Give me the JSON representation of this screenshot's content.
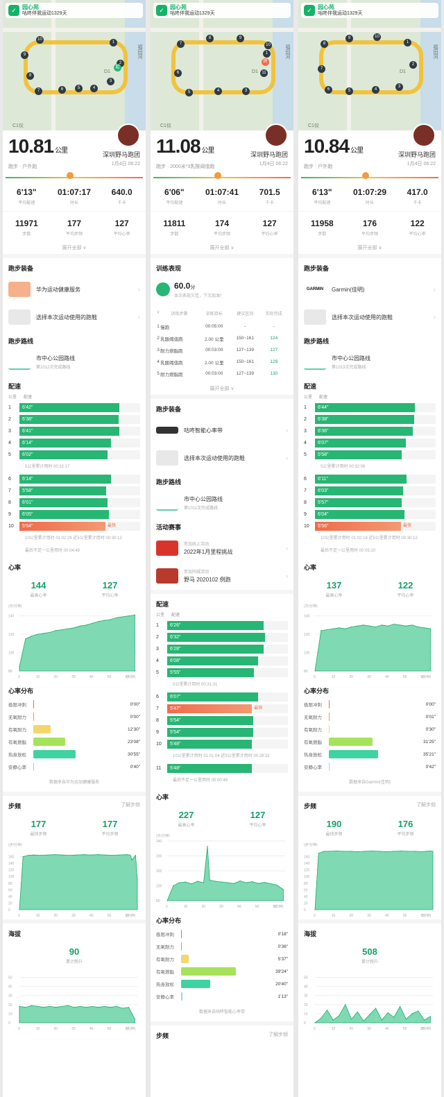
{
  "banner": {
    "brand": "园心苑",
    "text": "咕咚伴我运动1329天"
  },
  "map_labels": {
    "water": "福田河",
    "c1": "C1仪",
    "d1": "D1"
  },
  "columns": [
    {
      "distance": "10.81",
      "unit": "公里",
      "mode": "跑步 · 户外跑",
      "club": "深圳野马跑团",
      "date": "1月4日 06:22",
      "speed_left": "",
      "speed_right": "",
      "stats": [
        {
          "v": "6'13\"",
          "l": "平均配速"
        },
        {
          "v": "01:07:17",
          "l": "时长"
        },
        {
          "v": "640.0",
          "l": "千卡"
        }
      ],
      "stats2": [
        {
          "v": "11971",
          "l": "步数"
        },
        {
          "v": "177",
          "l": "平均步频"
        },
        {
          "v": "127",
          "l": "平均心率"
        }
      ],
      "more": "展开全部 ∨",
      "equip_title": "跑步装备",
      "equip": [
        {
          "label": "华为运动健康服务",
          "color": "#f7b18a"
        },
        {
          "label": "选择本次运动使用的跑鞋",
          "color": "#e8e8e8"
        }
      ],
      "route_title": "跑步路线",
      "route": {
        "name": "市中心公园路线",
        "sub": "第1012次完成路线"
      },
      "pace_title": "配速",
      "pace_hd": [
        "公里",
        "配速"
      ],
      "pace1": [
        {
          "n": "1",
          "p": "6'42\"",
          "f": 0.83
        },
        {
          "n": "2",
          "p": "6'38\"",
          "f": 0.82
        },
        {
          "n": "3",
          "p": "6'41\"",
          "f": 0.83
        },
        {
          "n": "4",
          "p": "6'14\"",
          "f": 0.76
        },
        {
          "n": "5",
          "p": "6'02\"",
          "f": 0.73
        }
      ],
      "pace1_note": "5公里累计用时 00:32:17",
      "pace2": [
        {
          "n": "6",
          "p": "6'14\"",
          "f": 0.76
        },
        {
          "n": "7",
          "p": "5'58\"",
          "f": 0.72
        },
        {
          "n": "8",
          "p": "6'01\"",
          "f": 0.73
        },
        {
          "n": "9",
          "p": "6'05\"",
          "f": 0.74
        },
        {
          "n": "10",
          "p": "5'54\"",
          "f": 0.71,
          "fast": true
        }
      ],
      "fast_tag": "最快",
      "pace2_note": "10公里累计用时 01:02:29  近5公里累计用时 00:30:12",
      "pace3_note": "最后不足一公里用时 00:04:48",
      "hr_title": "心率",
      "hr": [
        {
          "v": "144",
          "l": "最高心率"
        },
        {
          "v": "127",
          "l": "平均心率"
        }
      ],
      "hr_unit": "(次/分钟)",
      "zone_title": "心率分布",
      "zones": [
        {
          "n": "极限冲刺",
          "t": "0'00\"",
          "f": 0,
          "c": "#f06b4b"
        },
        {
          "n": "无氧耐力",
          "t": "0'00\"",
          "f": 0,
          "c": "#f39a3a"
        },
        {
          "n": "有氧耐力",
          "t": "12'30\"",
          "f": 0.2,
          "c": "#f5d66a"
        },
        {
          "n": "有氧燃脂",
          "t": "23'08\"",
          "f": 0.37,
          "c": "#a6e35a"
        },
        {
          "n": "热身放松",
          "t": "30'55\"",
          "f": 0.49,
          "c": "#3ed3a0"
        },
        {
          "n": "安静心率",
          "t": "0'40\"",
          "f": 0.01,
          "c": "#8fd9f0"
        }
      ],
      "zone_src": "数据来自华为运动健康服务",
      "cad_title": "步频",
      "cad_link": "了解步频",
      "cad": [
        {
          "v": "177",
          "l": "最快步频"
        },
        {
          "v": "177",
          "l": "平均步频"
        }
      ],
      "cad_unit": "(步/分钟)",
      "alt_title": "海拔",
      "alt": {
        "v": "90",
        "l": "累计爬升"
      }
    },
    {
      "distance": "11.08",
      "unit": "公里",
      "mode": "跑步 · 2000米*3乳酸阈值跑",
      "club": "深圳野马跑团",
      "date": "1月4日 06:22",
      "stats": [
        {
          "v": "6'06\"",
          "l": "平均配速"
        },
        {
          "v": "01:07:41",
          "l": "时长"
        },
        {
          "v": "701.5",
          "l": "千卡"
        }
      ],
      "stats2": [
        {
          "v": "11811",
          "l": "步数"
        },
        {
          "v": "174",
          "l": "平均步频"
        },
        {
          "v": "127",
          "l": "平均心率"
        }
      ],
      "more": "展开全部 ∨",
      "train_title": "训练表现",
      "train_score": "60.0",
      "train_score_unit": "分",
      "train_note": "本次表现欠佳，下次加油！",
      "train_hd": [
        "#",
        "训练步骤",
        "训练目标",
        "建议区间",
        "实际完成"
      ],
      "train_rows": [
        [
          "1",
          "慢跑",
          "00:05:00",
          "-",
          "-"
        ],
        [
          "2",
          "乳酸阈值跑",
          "2.00 公里",
          "150~161",
          "124"
        ],
        [
          "3",
          "耐力燃脂跑",
          "00:03:00",
          "127~139",
          "127"
        ],
        [
          "4",
          "乳酸阈值跑",
          "2.00 公里",
          "150~161",
          "129"
        ],
        [
          "5",
          "耐力燃脂跑",
          "00:03:00",
          "127~139",
          "130"
        ]
      ],
      "equip_title": "跑步装备",
      "equip": [
        {
          "label": "咕咚智能心率带",
          "color": "#333"
        },
        {
          "label": "选择本次运动使用的跑鞋",
          "color": "#e8e8e8"
        }
      ],
      "route_title": "跑步路线",
      "route": {
        "name": "市中心公园路线",
        "sub": "第1011次完成路线"
      },
      "event_title": "活动赛事",
      "events": [
        {
          "tag": "参加线上活动",
          "name": "2022年1月里程挑战",
          "color": "#d9342a"
        },
        {
          "tag": "参加同城活动",
          "name": "野马 2020102 例跑",
          "color": "#b93a2c"
        }
      ],
      "pace_title": "配速",
      "pace_hd": [
        "公里",
        "配速"
      ],
      "pace1": [
        {
          "n": "1",
          "p": "6'26\"",
          "f": 0.8
        },
        {
          "n": "2",
          "p": "6'32\"",
          "f": 0.81
        },
        {
          "n": "3",
          "p": "6'28\"",
          "f": 0.8
        },
        {
          "n": "4",
          "p": "6'08\"",
          "f": 0.75
        },
        {
          "n": "5",
          "p": "5'55\"",
          "f": 0.72
        }
      ],
      "pace1_note": "5公里累计用时 00:31:31",
      "pace2": [
        {
          "n": "6",
          "p": "6'07\"",
          "f": 0.75
        },
        {
          "n": "7",
          "p": "5'47\"",
          "f": 0.7,
          "fast": true
        },
        {
          "n": "8",
          "p": "5'54\"",
          "f": 0.71
        },
        {
          "n": "9",
          "p": "5'54\"",
          "f": 0.71
        },
        {
          "n": "10",
          "p": "5'48\"",
          "f": 0.7
        }
      ],
      "fast_tag": "最快",
      "pace2_note": "10公里累计用时 01:01:04  近5公里累计用时 00:29:32",
      "pace3": [
        {
          "n": "11",
          "p": "5'48\"",
          "f": 0.7
        }
      ],
      "pace3_note": "最后不足一公里用时 00:00:48",
      "hr_title": "心率",
      "hr": [
        {
          "v": "227",
          "l": "最高心率"
        },
        {
          "v": "127",
          "l": "平均心率"
        }
      ],
      "hr_unit": "(次/分钟)",
      "zone_title": "心率分布",
      "zones": [
        {
          "n": "极限冲刺",
          "t": "0'18\"",
          "f": 0.01,
          "c": "#f06b4b"
        },
        {
          "n": "无氧耐力",
          "t": "0'36\"",
          "f": 0.01,
          "c": "#f39a3a"
        },
        {
          "n": "有氧耐力",
          "t": "5'37\"",
          "f": 0.09,
          "c": "#f5d66a"
        },
        {
          "n": "有氧燃脂",
          "t": "39'24\"",
          "f": 0.64,
          "c": "#a6e35a"
        },
        {
          "n": "热身放松",
          "t": "20'40\"",
          "f": 0.34,
          "c": "#3ed3a0"
        },
        {
          "n": "安静心率",
          "t": "1'13\"",
          "f": 0.02,
          "c": "#8fd9f0"
        }
      ],
      "zone_src": "数据来自咕咚智能心率带",
      "cad_title": "步频",
      "cad_link": "了解步频"
    },
    {
      "distance": "10.84",
      "unit": "公里",
      "mode": "跑步 · 户外跑",
      "club": "深圳野马跑团",
      "date": "1月4日 06:22",
      "stats": [
        {
          "v": "6'13\"",
          "l": "平均配速"
        },
        {
          "v": "01:07:29",
          "l": "时长"
        },
        {
          "v": "417.0",
          "l": "千卡"
        }
      ],
      "stats2": [
        {
          "v": "11958",
          "l": "步数"
        },
        {
          "v": "176",
          "l": "平均步频"
        },
        {
          "v": "122",
          "l": "平均心率"
        }
      ],
      "more": "展开全部 ∨",
      "equip_title": "跑步装备",
      "equip": [
        {
          "label": "Garmin(佳明)",
          "color": "#fff"
        },
        {
          "label": "选择本次运动使用的跑鞋",
          "color": "#e8e8e8"
        }
      ],
      "route_title": "跑步路线",
      "route": {
        "name": "市中心公园路线",
        "sub": "第1013次完成路线"
      },
      "pace_title": "配速",
      "pace_hd": [
        "公里",
        "配速"
      ],
      "pace1": [
        {
          "n": "1",
          "p": "6'44\"",
          "f": 0.83
        },
        {
          "n": "2",
          "p": "6'38\"",
          "f": 0.82
        },
        {
          "n": "3",
          "p": "6'36\"",
          "f": 0.81
        },
        {
          "n": "4",
          "p": "6'07\"",
          "f": 0.75
        },
        {
          "n": "5",
          "p": "5'58\"",
          "f": 0.72
        }
      ],
      "pace1_note": "5公里累计用时 00:32:06",
      "pace2": [
        {
          "n": "6",
          "p": "6'11\"",
          "f": 0.76
        },
        {
          "n": "7",
          "p": "6'03\"",
          "f": 0.73
        },
        {
          "n": "8",
          "p": "5'57\"",
          "f": 0.72
        },
        {
          "n": "9",
          "p": "6'04\"",
          "f": 0.74
        },
        {
          "n": "10",
          "p": "5'56\"",
          "f": 0.71,
          "fast": true
        }
      ],
      "fast_tag": "最快",
      "pace2_note": "10公里累计用时 01:02:18  近5公里累计用时 00:30:12",
      "pace3_note": "最后不足一公里用时 00:05:10",
      "hr_title": "心率",
      "hr": [
        {
          "v": "137",
          "l": "最高心率"
        },
        {
          "v": "122",
          "l": "平均心率"
        }
      ],
      "hr_unit": "(次/分钟)",
      "zone_title": "心率分布",
      "zones": [
        {
          "n": "极限冲刺",
          "t": "0'00\"",
          "f": 0,
          "c": "#f06b4b"
        },
        {
          "n": "无氧耐力",
          "t": "0'01\"",
          "f": 0.005,
          "c": "#f39a3a"
        },
        {
          "n": "有氧耐力",
          "t": "0'30\"",
          "f": 0.01,
          "c": "#f5d66a"
        },
        {
          "n": "有氧燃脂",
          "t": "31'25\"",
          "f": 0.51,
          "c": "#a6e35a"
        },
        {
          "n": "热身放松",
          "t": "35'21\"",
          "f": 0.57,
          "c": "#3ed3a0"
        },
        {
          "n": "安静心率",
          "t": "0'42\"",
          "f": 0.01,
          "c": "#8fd9f0"
        }
      ],
      "zone_src": "数据来自Garmin(佳明)",
      "cad_title": "步频",
      "cad_link": "了解步频",
      "cad": [
        {
          "v": "190",
          "l": "最快步频"
        },
        {
          "v": "176",
          "l": "平均步频"
        }
      ],
      "cad_unit": "(步/分钟)",
      "alt_title": "海拔",
      "alt": {
        "v": "508",
        "l": "累计爬升"
      }
    }
  ],
  "chart_data": [
    {
      "type": "area",
      "series": [
        {
          "values": [
            85,
            115,
            118,
            120,
            121,
            122,
            124,
            125,
            126,
            127,
            129,
            130,
            132,
            134,
            135,
            136,
            138,
            139,
            140,
            141
          ]
        }
      ],
      "x": [
        0,
        3.4,
        6.8,
        10.2,
        13.6,
        17,
        20.4,
        23.8,
        27.2,
        30.6,
        34,
        37.4,
        40.8,
        44.2,
        47.6,
        51,
        54.4,
        57.8,
        61.2,
        64.6
      ],
      "xticks": [
        0,
        10,
        20,
        30,
        40,
        50,
        60
      ],
      "yticks": [
        80,
        100,
        120,
        140
      ],
      "ylim": [
        80,
        145
      ],
      "xlabel": "(分钟)",
      "ylabel": "(次/分钟)"
    },
    {
      "type": "area",
      "series": [
        {
          "values": [
            0,
            160,
            164,
            165,
            164,
            165,
            166,
            165,
            164,
            165,
            166,
            165,
            166,
            165,
            164,
            165,
            166,
            165,
            150,
            164,
            90
          ]
        }
      ],
      "x": [
        0,
        2,
        5,
        8,
        12,
        16,
        20,
        24,
        28,
        32,
        36,
        40,
        44,
        48,
        52,
        56,
        60,
        62,
        63,
        65,
        66
      ],
      "xticks": [
        0,
        10,
        20,
        30,
        40,
        50,
        60
      ],
      "yticks": [
        0,
        20,
        40,
        60,
        80,
        100,
        120,
        140,
        160
      ],
      "ylim": [
        0,
        180
      ],
      "xlabel": "(分钟)",
      "ylabel": "(步/分钟)"
    },
    {
      "type": "area",
      "series": [
        {
          "values": [
            18,
            17,
            19,
            18,
            17,
            18,
            17,
            18,
            19,
            17,
            18,
            17,
            18,
            17,
            18,
            17,
            18,
            16,
            17,
            4
          ]
        }
      ],
      "x": [
        0,
        3.4,
        6.8,
        10.2,
        13.6,
        17,
        20.4,
        23.8,
        27.2,
        30.6,
        34,
        37.4,
        40.8,
        44.2,
        47.6,
        51,
        54.4,
        57.8,
        61.2,
        64.6
      ],
      "xticks": [
        0,
        10,
        20,
        30,
        40,
        50,
        60
      ],
      "yticks": [
        0,
        10,
        20,
        30,
        40,
        50
      ],
      "ylim": [
        0,
        55
      ],
      "xlabel": "(分钟)",
      "ylabel": "(米)"
    },
    {
      "type": "area",
      "series": [
        {
          "values": [
            80,
            120,
            128,
            130,
            125,
            132,
            128,
            135,
            226,
            132,
            130,
            128,
            126,
            133,
            128,
            131,
            126,
            129,
            122,
            110
          ]
        }
      ],
      "x": [
        0,
        3.4,
        6.8,
        10.2,
        13.6,
        17,
        20.4,
        23.8,
        22.5,
        27.2,
        30.6,
        34,
        37.4,
        40.8,
        44.2,
        47.6,
        51,
        54.4,
        61.2,
        65
      ],
      "xticks": [
        0,
        10,
        20,
        30,
        40,
        50,
        60
      ],
      "yticks": [
        80,
        120,
        160,
        200,
        240
      ],
      "ylim": [
        80,
        240
      ],
      "xlabel": "(分钟)",
      "ylabel": "(次/分钟)"
    },
    {
      "type": "area",
      "series": [
        {
          "values": [
            80,
            124,
            125,
            126,
            127,
            126,
            128,
            129,
            130,
            129,
            128,
            130,
            129,
            131,
            130,
            129,
            130,
            128,
            127,
            126
          ]
        }
      ],
      "x": [
        0,
        3.4,
        6.8,
        10.2,
        13.6,
        17,
        20.4,
        23.8,
        27.2,
        30.6,
        34,
        37.4,
        40.8,
        44.2,
        47.6,
        51,
        54.4,
        57.8,
        61.2,
        64.6
      ],
      "xticks": [
        0,
        10,
        20,
        30,
        40,
        50,
        60
      ],
      "yticks": [
        80,
        100,
        120,
        140
      ],
      "ylim": [
        80,
        145
      ],
      "xlabel": "(分钟)",
      "ylabel": "(次/分钟)"
    },
    {
      "type": "area",
      "series": [
        {
          "values": [
            0,
            170,
            176,
            176,
            177,
            176,
            176,
            175,
            176,
            177,
            176,
            175,
            176,
            177,
            176,
            176,
            175,
            176,
            177,
            176
          ]
        }
      ],
      "x": [
        0,
        2,
        5,
        8,
        12,
        16,
        20,
        24,
        28,
        32,
        36,
        40,
        44,
        48,
        52,
        56,
        60,
        62,
        64,
        66
      ],
      "xticks": [
        0,
        10,
        20,
        30,
        40,
        50,
        60
      ],
      "yticks": [
        0,
        20,
        40,
        60,
        80,
        100,
        120,
        140,
        160
      ],
      "ylim": [
        0,
        180
      ],
      "xlabel": "(分钟)",
      "ylabel": "(步/分钟)"
    },
    {
      "type": "area",
      "series": [
        {
          "values": [
            0,
            5,
            14,
            3,
            8,
            20,
            4,
            12,
            2,
            9,
            16,
            3,
            11,
            6,
            18,
            4,
            10,
            13,
            3,
            7
          ]
        }
      ],
      "x": [
        0,
        3.4,
        6.8,
        10.2,
        13.6,
        17,
        20.4,
        23.8,
        27.2,
        30.6,
        34,
        37.4,
        40.8,
        44.2,
        47.6,
        51,
        54.4,
        57.8,
        61.2,
        64.6
      ],
      "xticks": [
        0,
        10,
        20,
        30,
        40,
        50,
        60
      ],
      "yticks": [
        0,
        10,
        20,
        30,
        40,
        50
      ],
      "ylim": [
        0,
        55
      ],
      "xlabel": "(分钟)",
      "ylabel": "(米)"
    }
  ]
}
